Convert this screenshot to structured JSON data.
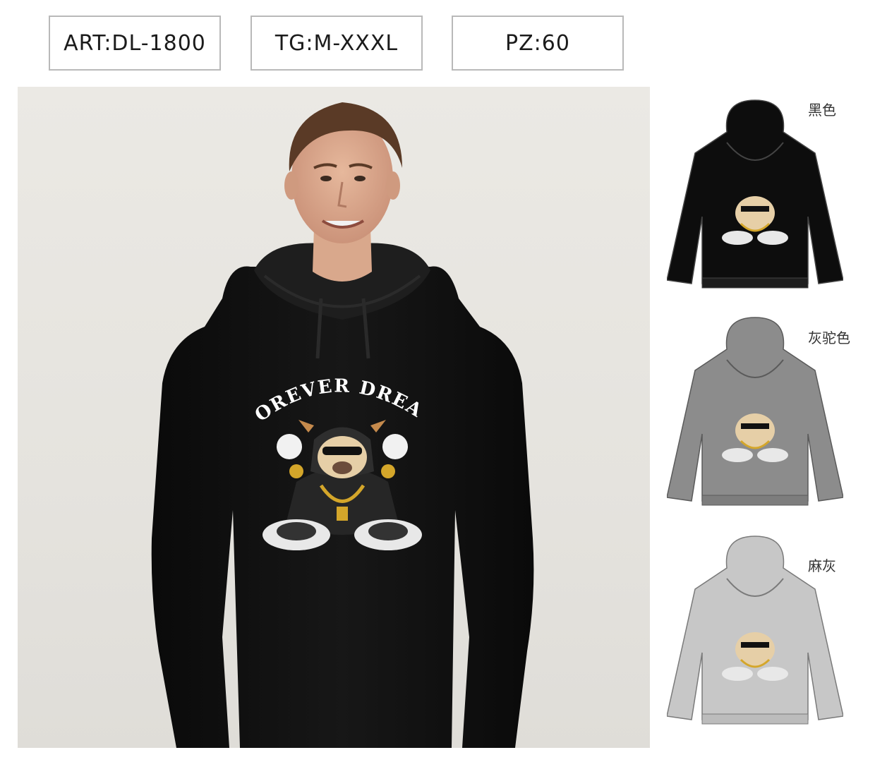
{
  "specs": {
    "art": "ART:DL-1800",
    "size_range": "TG:M-XXXL",
    "pieces": "PZ:60"
  },
  "print": {
    "slogan": "FOREVER DREAM"
  },
  "variants": [
    {
      "label": "黑色",
      "color": "#0d0d0d"
    },
    {
      "label": "灰驼色",
      "color": "#8c8c8c"
    },
    {
      "label": "麻灰",
      "color": "#c7c7c7"
    }
  ]
}
